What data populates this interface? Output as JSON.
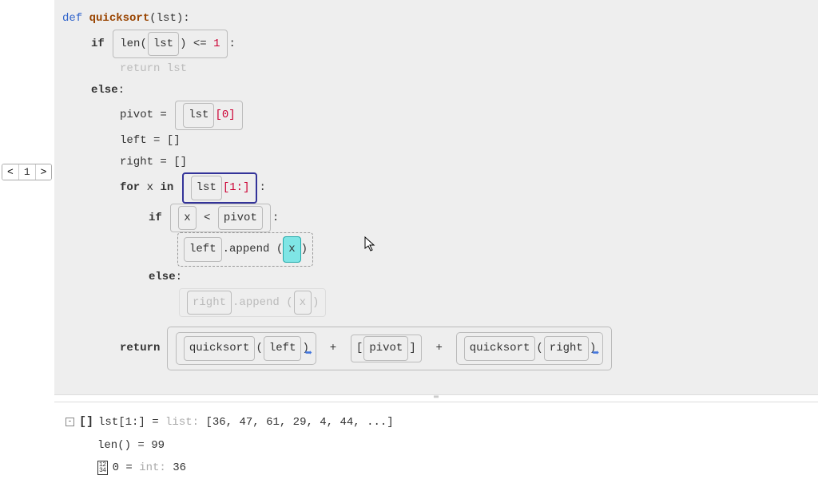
{
  "nav": {
    "prev": "<",
    "page": "1",
    "next": ">"
  },
  "code": {
    "def": "def",
    "fn_name": "quicksort",
    "param": "lst",
    "if": "if",
    "len": "len",
    "lst": "lst",
    "lte": "<=",
    "one": "1",
    "colon": ":",
    "return_lst": "return lst",
    "else": "else",
    "pivot": "pivot",
    "eq": " = ",
    "zero_idx": "[0]",
    "left": "left",
    "right": "right",
    "empty_list": " = []",
    "for": "for",
    "x": "x",
    "in": "in",
    "slice1": "[1:]",
    "lt": "<",
    "append": ".append",
    "paren_open": "(",
    "paren_close": ")",
    "return": "return",
    "quicksort": "quicksort",
    "plus": "+",
    "bracket_open": "[",
    "bracket_close": "]"
  },
  "inspector": {
    "row1_label": "lst[1:] = ",
    "row1_type": "list: ",
    "row1_value": "[36, 47, 61, 29, 4, 44, ...]",
    "row2_label": "len() = ",
    "row2_value": "99",
    "row3_label": "0 = ",
    "row3_type": "int: ",
    "row3_value": "36"
  }
}
